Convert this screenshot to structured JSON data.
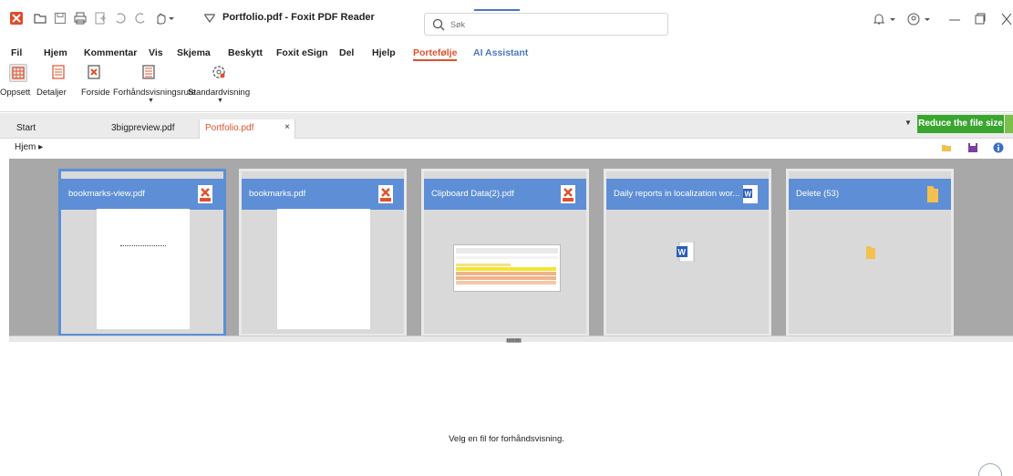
{
  "window": {
    "title": "Portfolio.pdf - Foxit PDF Reader",
    "search_placeholder": "Søk"
  },
  "menu": {
    "items": [
      "Fil",
      "Hjem",
      "Kommentar",
      "Vis",
      "Skjema",
      "Beskytt",
      "Foxit eSign",
      "Del",
      "Hjelp",
      "Portefølje",
      "AI Assistant"
    ],
    "active": "Portefølje"
  },
  "ribbon": {
    "buttons": [
      "Oppsett",
      "Detaljer",
      "Forside",
      "Forhåndsvisningsrute",
      "Standardvisning"
    ],
    "active": "Oppsett"
  },
  "tabs": {
    "items": [
      "Start",
      "3bigpreview.pdf",
      "Portfolio.pdf"
    ],
    "active": "Portfolio.pdf",
    "close_glyph": "×"
  },
  "promo": {
    "label": "Reduce the file size"
  },
  "breadcrumb": {
    "label": "Hjem ▸"
  },
  "cards": [
    {
      "name": "bookmarks-view.pdf",
      "type": "pdf",
      "selected": true
    },
    {
      "name": "bookmarks.pdf",
      "type": "pdf",
      "selected": false
    },
    {
      "name": "Clipboard Data(2).pdf",
      "type": "pdf",
      "selected": false
    },
    {
      "name": "Daily reports in localization wor...",
      "type": "word",
      "selected": false
    },
    {
      "name": "Delete (53)",
      "type": "folder",
      "selected": false
    }
  ],
  "preview": {
    "message": "Velg en fil for forhåndsvisning."
  },
  "colors": {
    "accent": "#e0502c",
    "card_header": "#5e8fd6",
    "promo_green": "#3aa52f",
    "ai_blue": "#4a78c0"
  }
}
